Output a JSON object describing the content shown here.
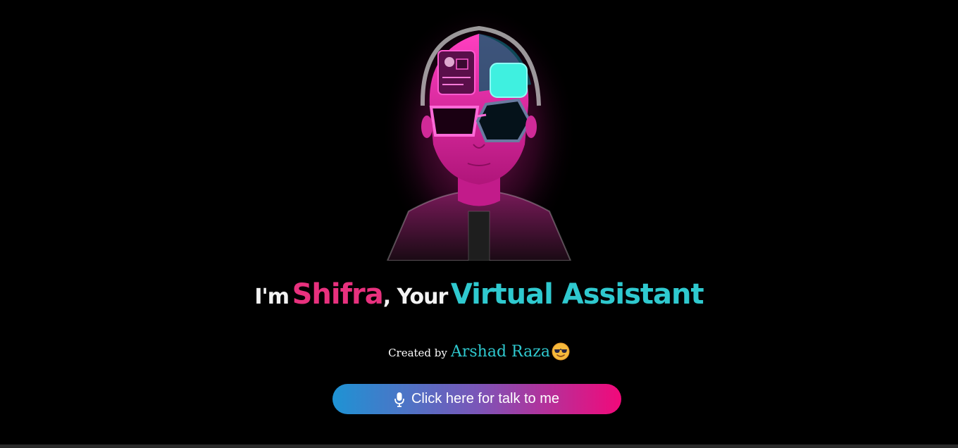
{
  "hero": {
    "avatar_image": "neon-cyborg-avatar"
  },
  "title": {
    "prefix": "I'm",
    "name": "Shifra",
    "middle": ", Your",
    "highlight": "Virtual Assistant"
  },
  "credit": {
    "prefix": "Created by",
    "author": "Arshad Raza",
    "emoji_icon": "smiling-face-with-sunglasses-icon"
  },
  "talk_button": {
    "icon": "microphone-icon",
    "label": "Click here for talk to me"
  },
  "colors": {
    "background": "#000000",
    "pink": "#e8317e",
    "cyan": "#2fc9cf",
    "button_gradient_start": "#1e93d4",
    "button_gradient_end": "#f2097a"
  }
}
